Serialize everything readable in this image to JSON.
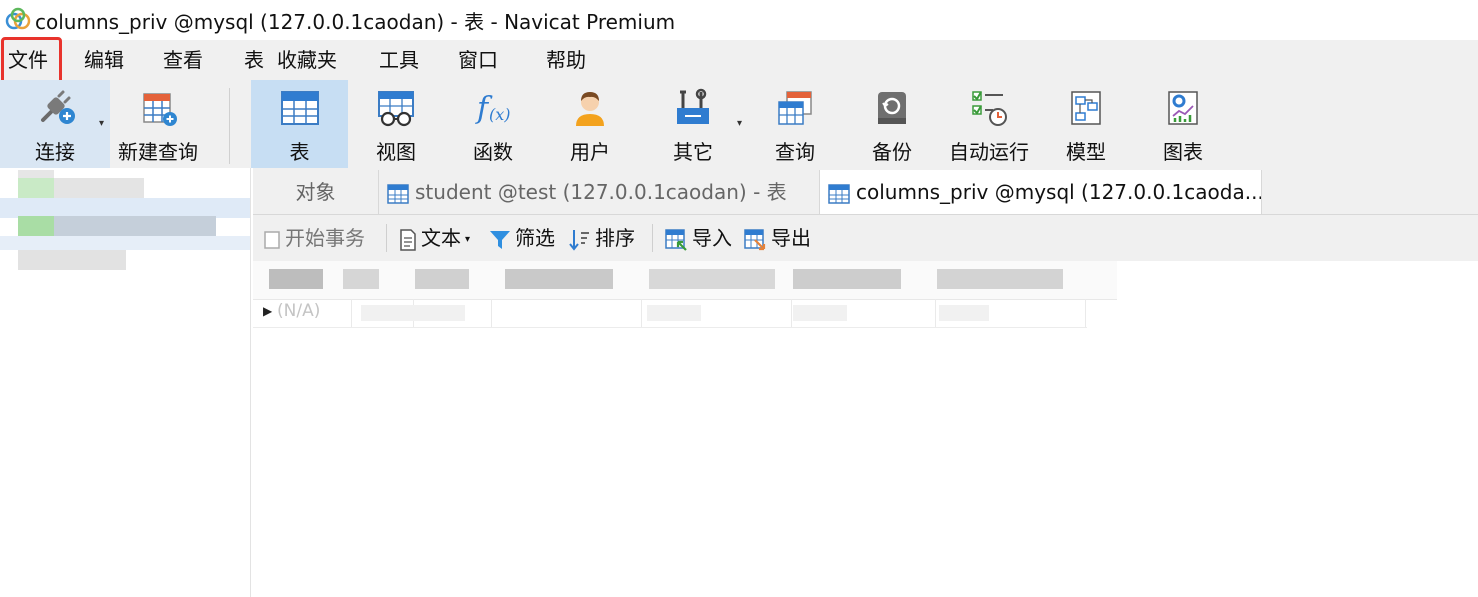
{
  "window": {
    "title": "columns_priv @mysql (127.0.0.1caodan) - 表 - Navicat Premium"
  },
  "menu": {
    "file": "文件",
    "edit": "编辑",
    "view": "查看",
    "table": "表",
    "favorites": "收藏夹",
    "tools": "工具",
    "window": "窗口",
    "help": "帮助"
  },
  "toolbar": {
    "connect": "连接",
    "new_query": "新建查询",
    "table": "表",
    "view": "视图",
    "function": "函数",
    "user": "用户",
    "other": "其它",
    "query": "查询",
    "backup": "备份",
    "automation": "自动运行",
    "model": "模型",
    "chart": "图表"
  },
  "tabs": {
    "objects": "对象",
    "tab1": "student @test (127.0.0.1caodan) - 表",
    "tab2": "columns_priv @mysql (127.0.0.1caoda..."
  },
  "subtoolbar": {
    "begin_transaction": "开始事务",
    "text": "文本",
    "filter": "筛选",
    "sort": "排序",
    "import": "导入",
    "export": "导出"
  },
  "grid": {
    "null_cell": "(N/A)"
  },
  "colors": {
    "highlight": "#e8332c",
    "active_tab_button": "#c7def3",
    "toolbar_bg": "#f0f0f0"
  }
}
